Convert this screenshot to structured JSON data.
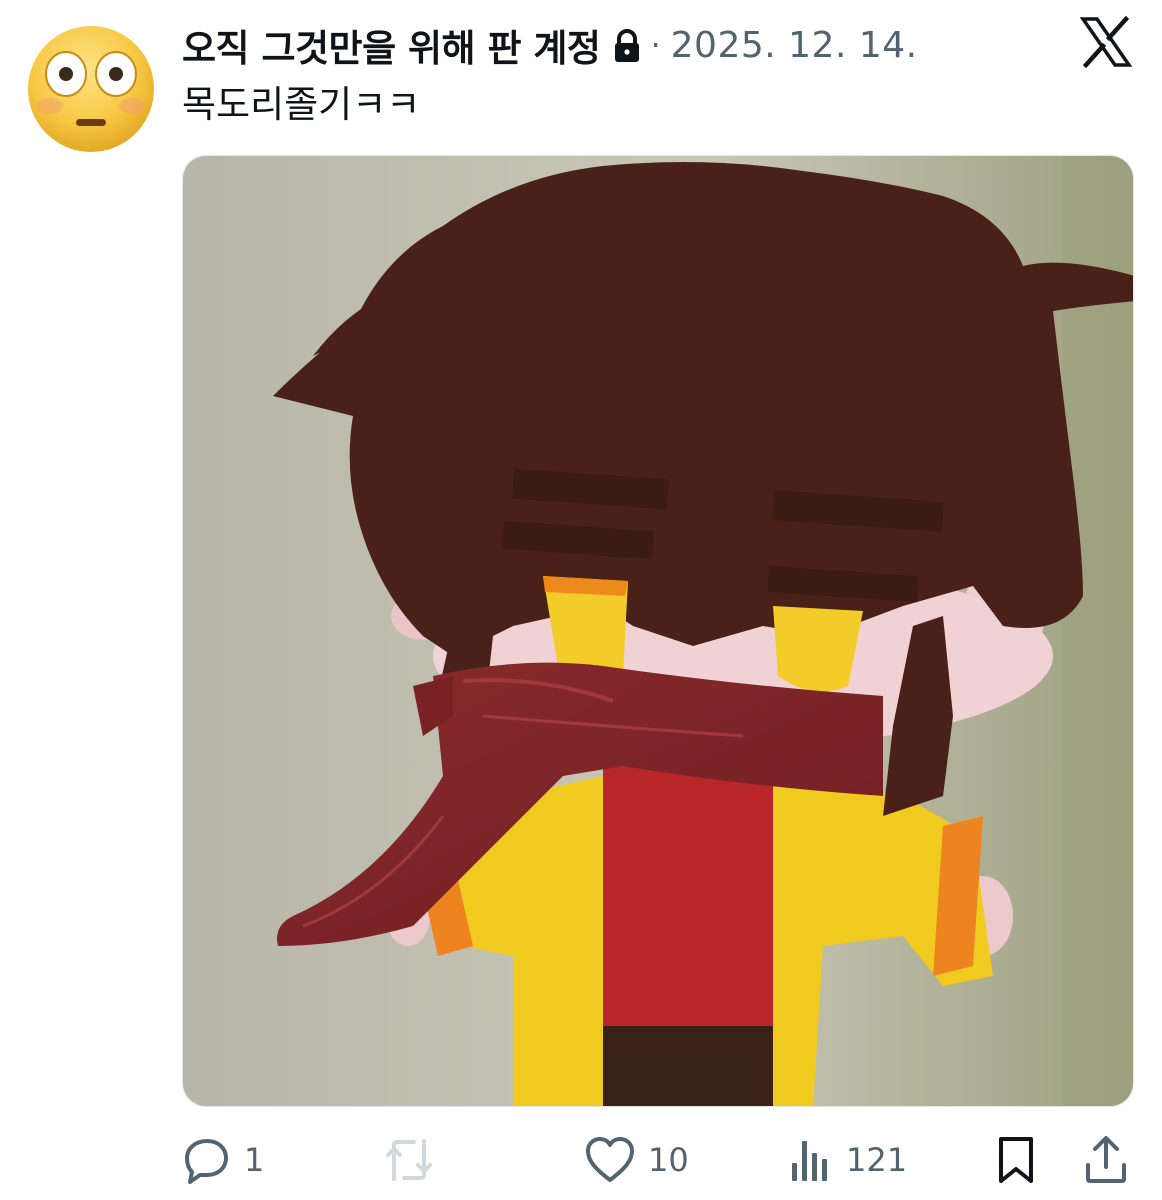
{
  "tweet": {
    "display_name": "오직 그것만을 위해 판 계정",
    "protected_icon": "lock-icon",
    "separator": "·",
    "date": "2025. 12. 14.",
    "text": "목도리졸기ㅋㅋ",
    "avatar_icon": "flushed-face-emoji",
    "platform_icon": "x-logo-icon",
    "media_alt": "felt plush doll seen from behind with brown hair, dark red scarf and yellow jacket"
  },
  "actions": {
    "reply": {
      "icon": "reply-icon",
      "count": "1"
    },
    "repost": {
      "icon": "repost-icon",
      "count": ""
    },
    "like": {
      "icon": "heart-icon",
      "count": "10"
    },
    "views": {
      "icon": "views-icon",
      "count": "121"
    },
    "bookmark": {
      "icon": "bookmark-icon"
    },
    "share": {
      "icon": "share-icon"
    }
  },
  "colors": {
    "text_primary": "#0f1419",
    "text_secondary": "#536471",
    "repost_disabled": "#cfd9de"
  }
}
